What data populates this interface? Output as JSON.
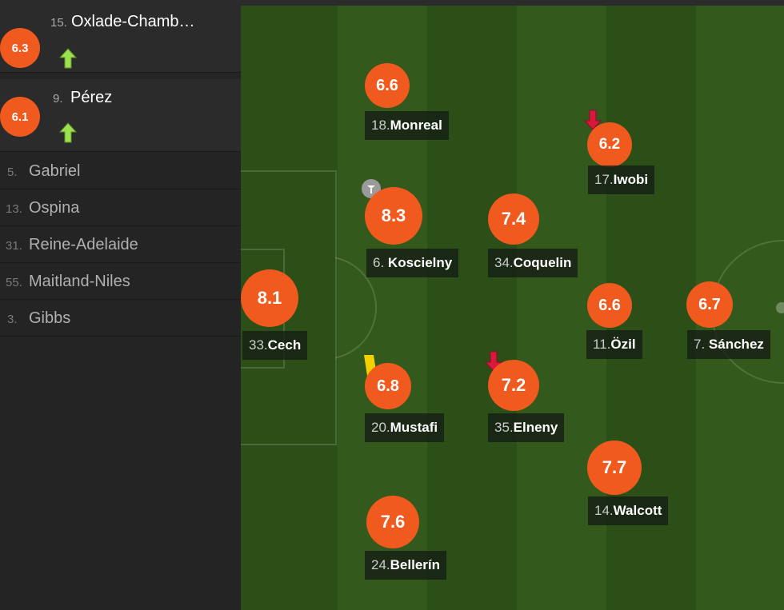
{
  "substitutes_in": [
    {
      "rating": "6.3",
      "number": "15.",
      "name": "Oxlade-Chamb…",
      "icon": "sub-in-arrow-icon"
    },
    {
      "rating": "6.1",
      "number": "9.",
      "name": "Pérez",
      "icon": "sub-in-arrow-icon"
    }
  ],
  "bench": [
    {
      "number": "5.",
      "name": "Gabriel"
    },
    {
      "number": "13.",
      "name": "Ospina"
    },
    {
      "number": "31.",
      "name": "Reine-Adelaide"
    },
    {
      "number": "55.",
      "name": "Maitland-Niles"
    },
    {
      "number": "3.",
      "name": "Gibbs"
    }
  ],
  "players": [
    {
      "rating": "8.1",
      "number": "33.",
      "name": "Cech"
    },
    {
      "rating": "6.6",
      "number": "18.",
      "name": "Monreal"
    },
    {
      "rating": "8.3",
      "number": "6.",
      "name": "Koscielny",
      "icon": "goal-ball-icon"
    },
    {
      "rating": "6.8",
      "number": "20.",
      "name": "Mustafi",
      "icon": "yellow-card-icon"
    },
    {
      "rating": "7.6",
      "number": "24.",
      "name": "Bellerín"
    },
    {
      "rating": "7.4",
      "number": "34.",
      "name": "Coquelin"
    },
    {
      "rating": "7.2",
      "number": "35.",
      "name": "Elneny",
      "icon": "sub-out-arrow-icon"
    },
    {
      "rating": "6.2",
      "number": "17.",
      "name": "Iwobi",
      "icon": "sub-out-arrow-icon"
    },
    {
      "rating": "6.6",
      "number": "11.",
      "name": "Özil"
    },
    {
      "rating": "7.7",
      "number": "14.",
      "name": "Walcott"
    },
    {
      "rating": "6.7",
      "number": "7.",
      "name": "Sánchez"
    }
  ],
  "colors": {
    "rating_badge": "#f05a1e",
    "pitch_dark": "#2b4f17",
    "pitch_light": "#33591c",
    "sub_in_arrow": "#9be04e",
    "sub_out_arrow": "#d9183b",
    "yellow_card": "#f5d000"
  }
}
